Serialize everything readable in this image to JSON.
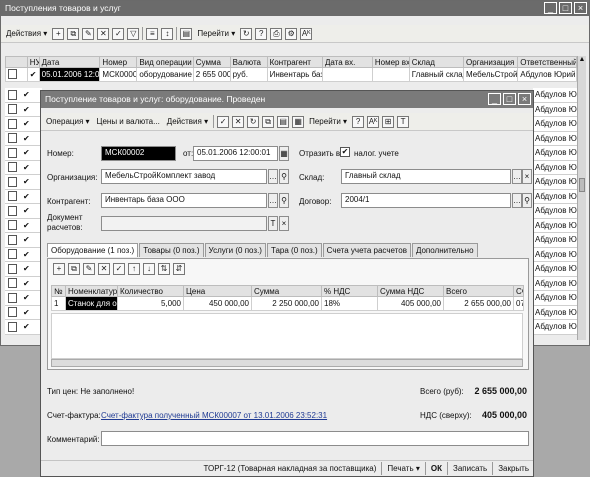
{
  "list_window": {
    "title": "Поступления товаров и услуг",
    "title_bar_color": "#6b6b6b",
    "toolbar": {
      "actions_label": "Действия",
      "goto_label": "Перейти",
      "help_label": "?"
    },
    "columns": [
      "НУ",
      "Дата",
      "Номер",
      "Вид операции",
      "Сумма",
      "Валюта",
      "Контрагент",
      "Дата вх.",
      "Номер вх.",
      "Склад",
      "Организация",
      "Ответственный"
    ],
    "first_row": {
      "nu": "✔",
      "date": "05.01.2006 12:00:01",
      "number": "МСК00002",
      "operation": "оборудование",
      "sum": "2 655 000,00",
      "currency": "руб.",
      "counterparty": "Инвентарь баз...",
      "date_in": "",
      "number_in": "",
      "warehouse": "Главный склад",
      "organization": "МебельСтройК...",
      "responsible": "Абдулов Юрий..."
    },
    "responsible_values": [
      "Абдулов Юрий...",
      "Абдулов Юрий...",
      "Абдулов Юрий...",
      "Абдулов Юрий...",
      "Абдулов Юрий...",
      "Абдулов Юрий...",
      "Абдулов Юрий...",
      "Абдулов Юрий...",
      "Абдулов Юрий...",
      "Абдулов Юрий...",
      "Абдулов Юрий...",
      "Абдулов Юрий...",
      "Абдулов Юрий...",
      "Абдулов Юрий...",
      "Абдулов Юрий...",
      "Абдулов Юрий...",
      "Абдулов Юрий..."
    ]
  },
  "doc_window": {
    "title": "Поступление товаров и услуг: оборудование. Проведен",
    "title_bar_color": "#7a7a7a",
    "toolbar": {
      "operation_label": "Операция",
      "prices_label": "Цены и валюта...",
      "actions_label": "Действия",
      "goto_label": "Перейти",
      "help_label": "?"
    },
    "number_label": "Номер:",
    "number_value": "МСК00002",
    "from_label": "от:",
    "date_value": "05.01.2006 12:00:01",
    "reflect_label": "Отразить в:",
    "tax_account_label": "налог. учете",
    "tax_account_checked": "✔",
    "org_label": "Организация:",
    "org_value": "МебельСтройКомплект завод",
    "warehouse_label": "Склад:",
    "warehouse_value": "Главный склад",
    "counterparty_label": "Контрагент:",
    "counterparty_value": "Инвентарь база ООО",
    "contract_label": "Договор:",
    "contract_value": "2004/1",
    "settlement_doc_label_1": "Документ",
    "settlement_doc_label_2": "расчетов:",
    "settlement_doc_value": "",
    "tabs": [
      "Оборудование (1 поз.)",
      "Товары (0 поз.)",
      "Услуги (0 поз.)",
      "Тара (0 поз.)",
      "Счета учета расчетов",
      "Дополнительно"
    ],
    "table": {
      "columns": [
        "№",
        "Номенклатура",
        "Количество",
        "Цена",
        "Сумма",
        "% НДС",
        "Сумма НДС",
        "Всего",
        "Сч"
      ],
      "rows": [
        {
          "n": "1",
          "nomenclature": "Станок для ок...",
          "quantity": "5,000",
          "price": "450 000,00",
          "sum": "2 250 000,00",
          "vat_rate": "18%",
          "vat_sum": "405 000,00",
          "total": "2 655 000,00",
          "account": "07"
        }
      ]
    },
    "price_type_text": "Тип цен: Не заполнено!",
    "total_label": "Всего (руб):",
    "total_value": "2 655 000,00",
    "invoice_label": "Счет-фактура:",
    "invoice_link": "Счет-фактура полученный МСК00007 от 13.01.2006 23:52:31",
    "vat_label": "НДС (сверху):",
    "vat_value": "405 000,00",
    "comment_label": "Комментарий:",
    "comment_value": "",
    "footer": {
      "torg12_label": "ТОРГ-12 (Товарная накладная за поставщика)",
      "print_label": "Печать",
      "ok_label": "ОК",
      "save_label": "Записать",
      "close_label": "Закрыть"
    }
  }
}
